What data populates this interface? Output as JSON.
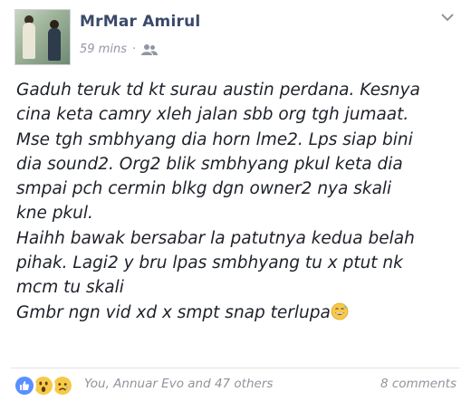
{
  "post": {
    "author": "MrMar Amirul",
    "time": "59 mins",
    "separator": "·",
    "audience_icon": "friends-icon",
    "options_icon": "chevron-down-icon",
    "body_lines": [
      "Gaduh teruk td kt surau austin perdana. Kesnya",
      "cina keta camry xleh jalan sbb org tgh jumaat.",
      "Mse tgh smbhyang dia horn lme2. Lps siap bini",
      "dia sound2. Org2 blik smbhyang pkul keta dia",
      "smpai pch cermin blkg dgn owner2 nya skali",
      "kne pkul.",
      "Haihh bawak bersabar la patutnya kedua belah",
      "pihak. Lagi2 y bru lpas smbhyang tu x ptut nk",
      "mcm tu skali",
      "Gmbr ngn vid xd x smpt snap terlupa"
    ],
    "trailing_emoji": "grinning-sweat-emoji",
    "reactions": [
      "like-icon",
      "wow-icon",
      "sad-icon"
    ],
    "reaction_names": "You, Annuar Evo and 47 others",
    "comments": "8 comments",
    "colors": {
      "author": "#3b4a6b",
      "like": "#5890ff",
      "emoji": "#f7c948",
      "muted": "#90949c"
    }
  }
}
